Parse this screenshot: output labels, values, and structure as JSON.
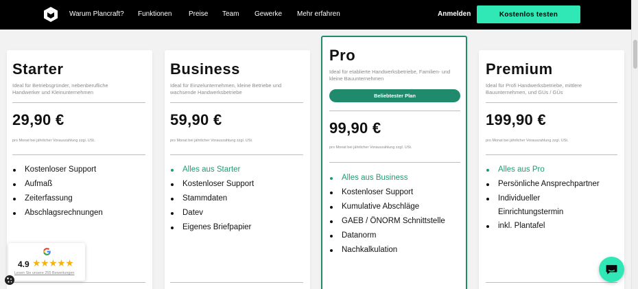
{
  "nav": {
    "links": [
      "Warum Plancraft?",
      "Funktionen",
      "Preise",
      "Team",
      "Gewerke",
      "Mehr erfahren"
    ],
    "login": "Anmelden",
    "cta": "Kostenlos testen"
  },
  "plans": [
    {
      "name": "Starter",
      "description": "Ideal für Betriebsgründer, nebenberufliche Handwerker und Kleinunternehmen",
      "price": "29,90 €",
      "price_note": "pro Monat bei jährlicher Vorauszahlung zzgl. USt.",
      "features": [
        "Kostenloser Support",
        "Aufmaß",
        "Zeiterfassung",
        "Abschlagsrechnungen"
      ]
    },
    {
      "name": "Business",
      "description": "Ideal für Einzelunternehmen, kleine Betriebe und wachsende Handwerksbetriebe",
      "price": "59,90 €",
      "price_note": "pro Monat bei jährlicher Vorauszahlung zzgl. USt.",
      "features": [
        "Alles aus Starter",
        "Kostenloser Support",
        "Stammdaten",
        "Datev",
        "Eigenes Briefpapier"
      ]
    },
    {
      "name": "Pro",
      "description": "Ideal für etablierte Handwerksbetriebe, Familien- und kleine Bauunternehmen",
      "badge": "Beliebtester Plan",
      "price": "99,90 €",
      "price_note": "pro Monat bei jährlicher Vorauszahlung zzgl. USt.",
      "features": [
        "Alles aus Business",
        "Kostenloser Support",
        "Kumulative Abschläge",
        "GAEB / ÖNORM Schnittstelle",
        "Datanorm",
        "Nachkalkulation"
      ]
    },
    {
      "name": "Premium",
      "description": "Ideal für Profi Handwerksbetriebe, mittlere Bauunternehmen, und GUs / GÜs",
      "price": "199,90 €",
      "price_note": "pro Monat bei jährlicher Vorauszahlung zzgl. USt.",
      "features": [
        "Alles aus Pro",
        "Persönliche Ansprechpartner",
        "Individueller Einrichtungstermin",
        "inkl. Plantafel"
      ]
    }
  ],
  "review": {
    "rating": "4.9",
    "stars": "★★★★★",
    "link": "Lesen Sie unsere 255 Bewertungen"
  },
  "colors": {
    "accent": "#2fe8b5",
    "brand_green": "#1f8a6c",
    "highlight_text": "#1f9a73"
  }
}
